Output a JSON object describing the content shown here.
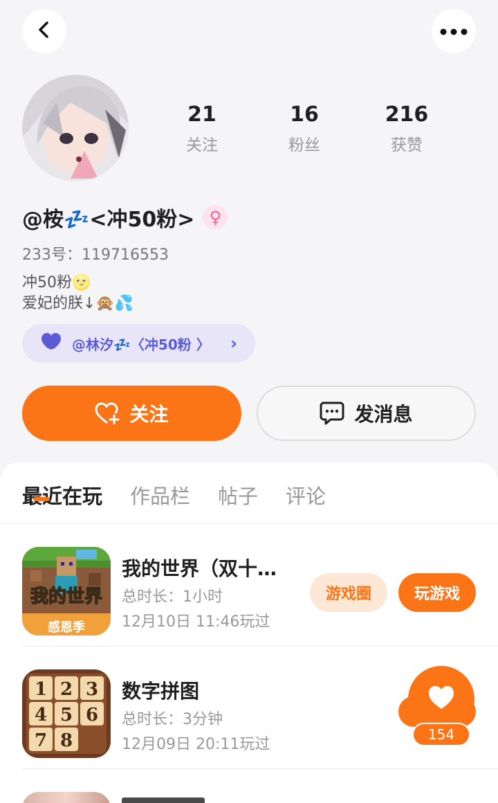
{
  "header": {
    "back_icon": "chevron-left-icon",
    "more_icon": "more-dots-icon"
  },
  "profile": {
    "stats": [
      {
        "value": "21",
        "label": "关注"
      },
      {
        "value": "16",
        "label": "粉丝"
      },
      {
        "value": "216",
        "label": "获赞"
      }
    ],
    "username": "@桉💤<冲50粉>",
    "gender_symbol": "♀",
    "uid": "233号：119716553",
    "bio_line1": "冲50粉🌝",
    "bio_line2": "爱妃的朕↓🙊💦",
    "cp_label": "@林汐💤〈冲50粉 〉",
    "cp_arrow": "›"
  },
  "actions": {
    "follow_label": "关注",
    "message_label": "发消息"
  },
  "tabs": [
    {
      "label": "最近在玩"
    },
    {
      "label": "作品栏"
    },
    {
      "label": "帖子"
    },
    {
      "label": "评论"
    }
  ],
  "games": [
    {
      "title": "我的世界（双十二...",
      "icon_text": "我的世界",
      "icon_subtext": "感恩季",
      "duration": "总时长：1小时",
      "last_played": "12月10日 11:46玩过",
      "circle_label": "游戏圈",
      "play_label": "玩游戏"
    },
    {
      "title": "数字拼图",
      "tiles": [
        "1",
        "2",
        "3",
        "4",
        "5",
        "6",
        "7",
        "8"
      ],
      "duration": "总时长：3分钟",
      "last_played": "12月09日 20:11玩过"
    }
  ],
  "floating_like": {
    "count": "154"
  },
  "colors": {
    "accent": "#fb7415",
    "cp": "#5b5bd6"
  }
}
